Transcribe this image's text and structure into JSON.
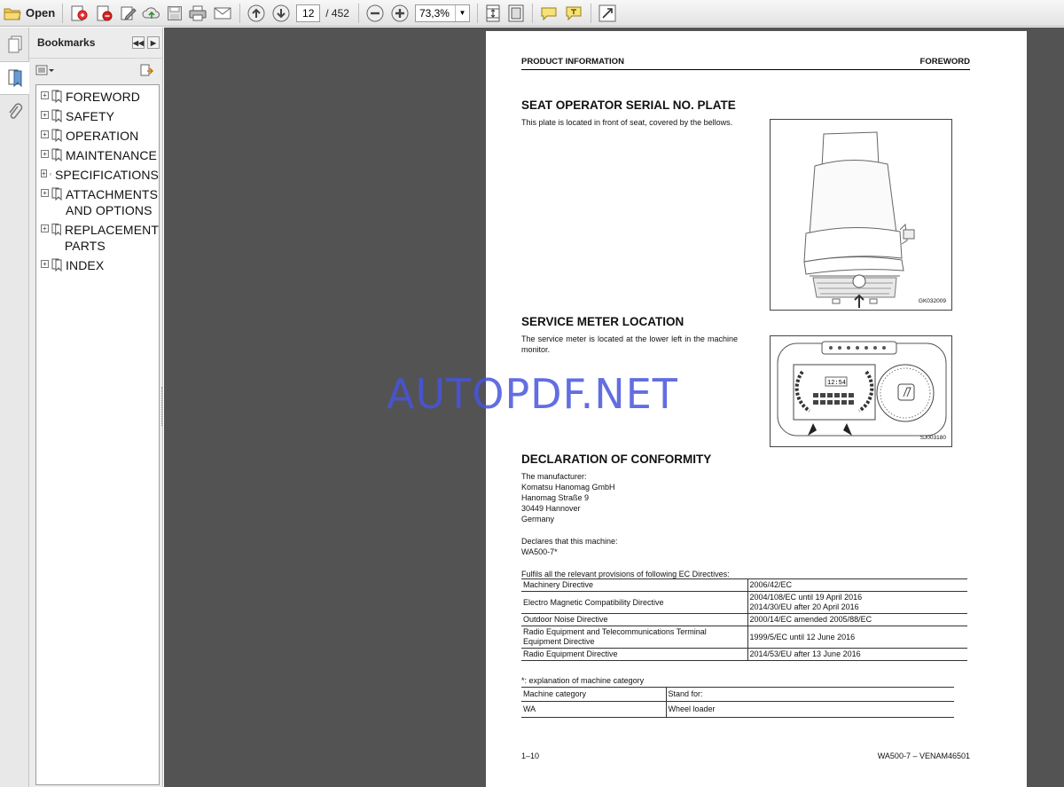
{
  "toolbar": {
    "open_label": "Open",
    "page_current": "12",
    "page_total": "/ 452",
    "zoom": "73,3%"
  },
  "bookmarks_panel": {
    "title": "Bookmarks",
    "items": [
      {
        "label": "FOREWORD"
      },
      {
        "label": "SAFETY"
      },
      {
        "label": "OPERATION"
      },
      {
        "label": "MAINTENANCE"
      },
      {
        "label": "SPECIFICATIONS"
      },
      {
        "label": "ATTACHMENTS AND OPTIONS",
        "line1": "ATTACHMENTS",
        "line2": "AND OPTIONS"
      },
      {
        "label": "REPLACEMENT PARTS",
        "line1": "REPLACEMENT",
        "line2": "PARTS"
      },
      {
        "label": "INDEX"
      }
    ]
  },
  "document": {
    "header_left": "PRODUCT INFORMATION",
    "header_right": "FOREWORD",
    "seat_title": "SEAT OPERATOR SERIAL NO. PLATE",
    "seat_text": "This plate is located in front of seat, covered by the bellows.",
    "seat_fig_code": "GK032009",
    "meter_title": "SERVICE METER LOCATION",
    "meter_text": "The service meter is located at the lower left in the machine monitor.",
    "meter_fig_code": "SJ003180",
    "meter_clock": "12:54",
    "decl_title": "DECLARATION OF CONFORMITY",
    "manufacturer_lines": [
      "The manufacturer:",
      "Komatsu Hanomag GmbH",
      "Hanomag Straße 9",
      "30449 Hannover",
      "Germany"
    ],
    "declares": "Declares that this machine:",
    "machine": "WA500-7*",
    "fulfils": "Fulfils all the relevant provisions of following EC Directives:",
    "directives": [
      {
        "name": "Machinery Directive",
        "value": "2006/42/EC"
      },
      {
        "name": "Electro Magnetic Compatibility Directive",
        "value": "2004/108/EC until 19 April 2016\n2014/30/EU after 20 April 2016"
      },
      {
        "name": "Outdoor Noise Directive",
        "value": "2000/14/EC amended 2005/88/EC"
      },
      {
        "name": "Radio Equipment and Telecommunications Terminal Equipment Directive",
        "value": "1999/5/EC until 12 June 2016"
      },
      {
        "name": "Radio Equipment Directive",
        "value": "2014/53/EU after 13 June 2016"
      }
    ],
    "category_note": "*: explanation of machine category",
    "category_headers": [
      "Machine category",
      "Stand for:"
    ],
    "category_rows": [
      [
        "WA",
        "Wheel loader"
      ]
    ],
    "footer_left": "1–10",
    "footer_right": "WA500-7 – VENAM46501",
    "watermark": "AUTOPDF.NET"
  },
  "colors": {
    "viewer_bg": "#535353",
    "watermark": "#4655dc"
  }
}
